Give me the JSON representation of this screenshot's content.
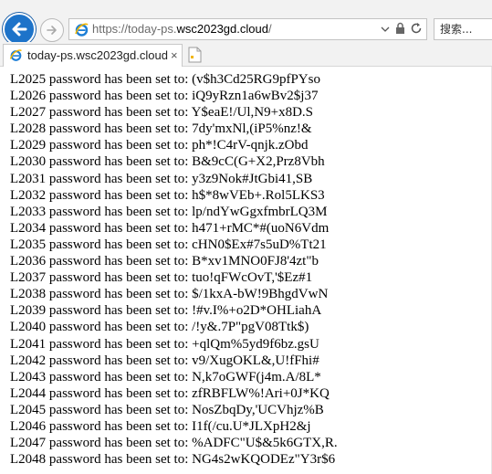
{
  "browser": {
    "url_prefix": "https://today-ps.",
    "url_domain": "wsc2023gd.cloud",
    "url_suffix": "/",
    "search_placeholder": "搜索...",
    "tab_title": "today-ps.wsc2023gd.cloud",
    "tab_close": "×"
  },
  "page": {
    "lines": [
      "L2025 password has been set to: (v$h3Cd25RG9pfPYso",
      "L2026 password has been set to: iQ9yRzn1a6wBv2$j37",
      "L2027 password has been set to: Y$eaE!/Ul,N9+x8D.S",
      "L2028 password has been set to: 7dy'mxNl,(iP5%nz!&",
      "L2029 password has been set to: ph*!C4rV-qnjk.zObd",
      "L2030 password has been set to: B&9cC(G+X2,Prz8Vbh",
      "L2031 password has been set to: y3z9Nok#JtGbi41,SB",
      "L2032 password has been set to: h$*8wVEb+.Rol5LKS3",
      "L2033 password has been set to: lp/ndYwGgxfmbrLQ3M",
      "L2034 password has been set to: h471+rMC*#(uoN6Vdm",
      "L2035 password has been set to: cHN0$Ex#7s5uD%Tt21",
      "L2036 password has been set to: B*xv1MNO0FJ8'4zt\"b",
      "L2037 password has been set to: tuo!qFWcOvT,'$Ez#1",
      "L2038 password has been set to: $/1kxA-bW!9BhgdVwN",
      "L2039 password has been set to: !#v.I%+o2D*OHLiahA",
      "L2040 password has been set to: /!y&.7P\"pgV08Ttk$)",
      "L2041 password has been set to: +qlQm%5yd9f6bz.gsU",
      "L2042 password has been set to: v9/XugOKL&,U!fFhi#",
      "L2043 password has been set to: N,k7oGWF(j4m.A/8L*",
      "L2044 password has been set to: zfRBFLW%!Ari+0J*KQ",
      "L2045 password has been set to: NosZbqDy,'UCVhjz%B",
      "L2046 password has been set to: I1f(/cu.U*JLXpH2&j",
      "L2047 password has been set to: %ADFC\"U$&5k6GTX,R.",
      "L2048 password has been set to: NG4s2wKQODEz\"Y3r$6"
    ]
  }
}
